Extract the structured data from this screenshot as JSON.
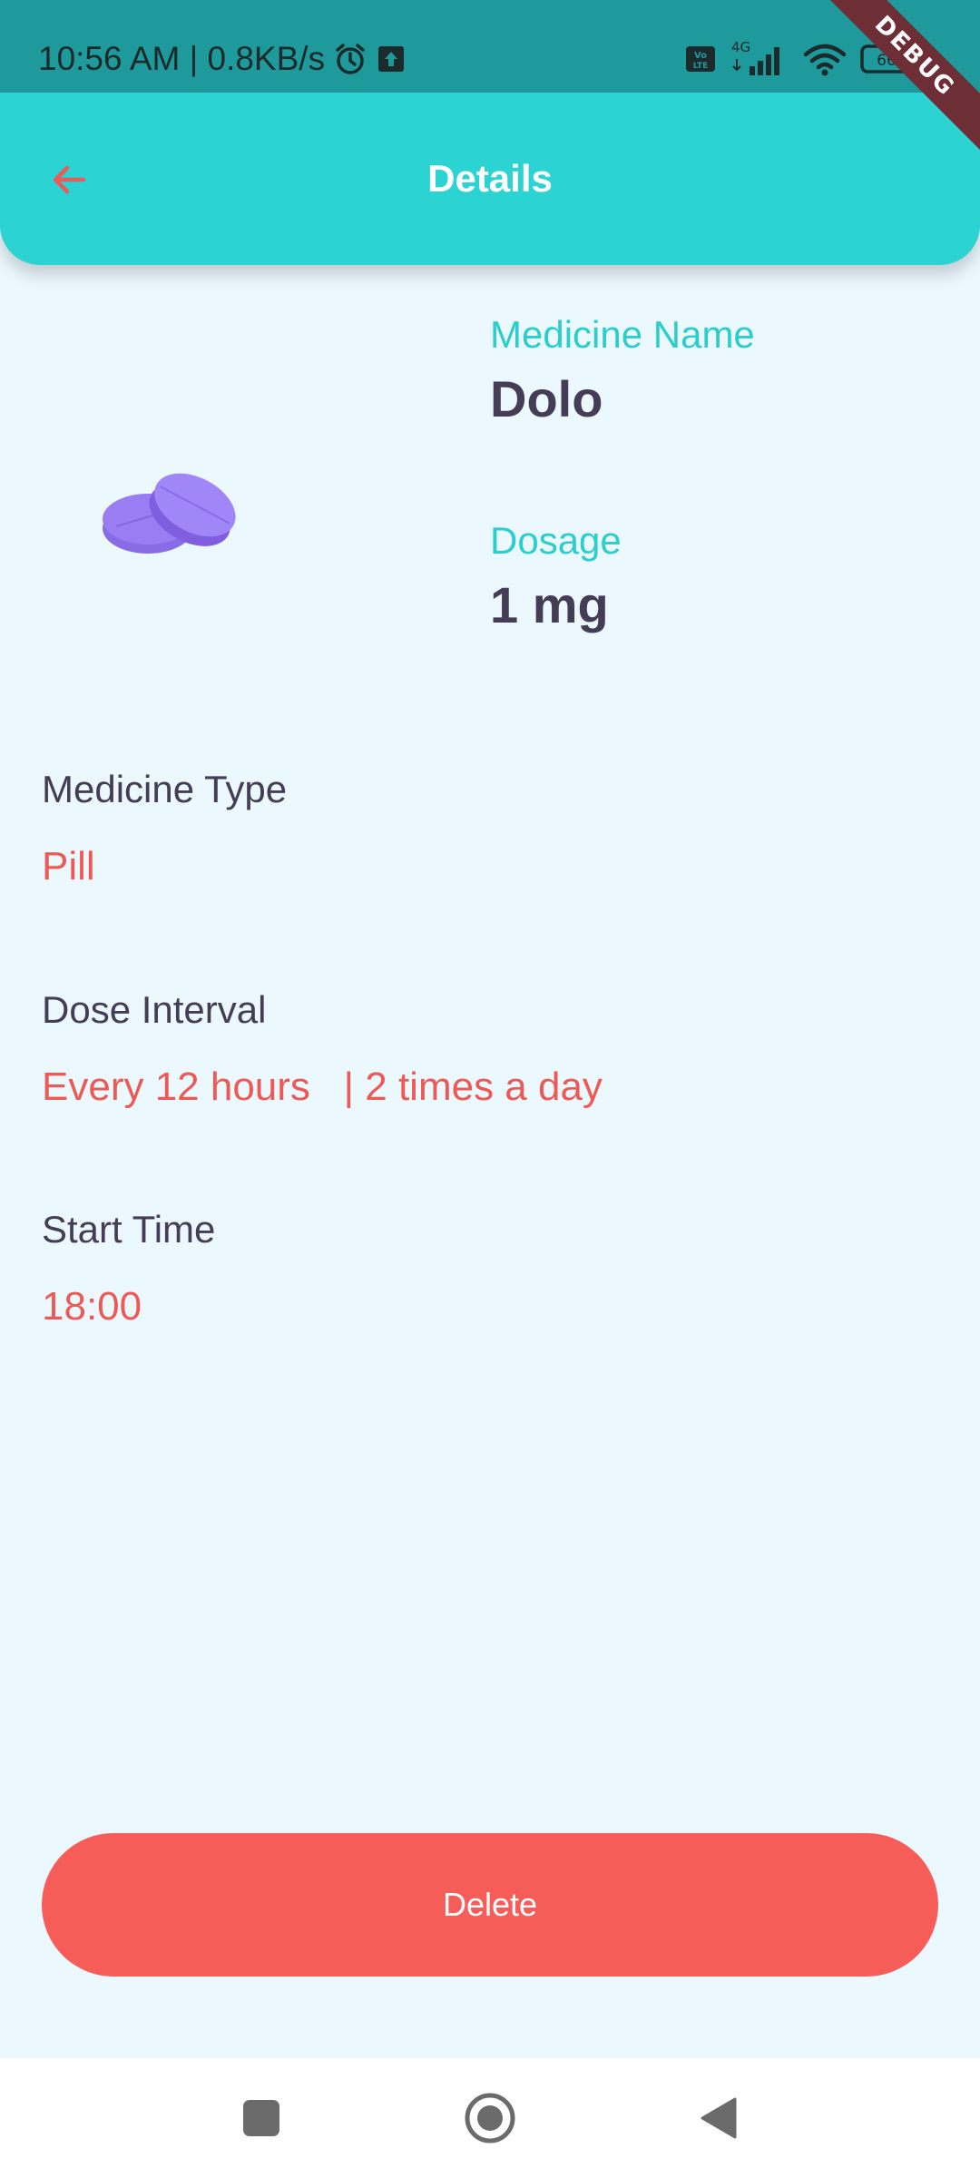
{
  "status_bar": {
    "time_speed": "10:56 AM | 0.8KB/s",
    "network": "4G",
    "volte": "Vo LTE",
    "battery": "66",
    "icons": [
      "alarm-icon",
      "upload-icon",
      "volte-icon",
      "signal-icon",
      "wifi-icon",
      "battery-icon"
    ]
  },
  "debug_banner": "DEBUG",
  "app_bar": {
    "title": "Details",
    "back_icon": "arrow-left-icon"
  },
  "medicine": {
    "name_label": "Medicine Name",
    "name": "Dolo",
    "dosage_label": "Dosage",
    "dosage": "1 mg",
    "image_icon": "pill-icon"
  },
  "details": {
    "type_label": "Medicine Type",
    "type": "Pill",
    "interval_label": "Dose Interval",
    "interval": "Every 12 hours   | 2 times a day",
    "start_label": "Start Time",
    "start": "18:00"
  },
  "actions": {
    "delete_label": "Delete"
  },
  "colors": {
    "teal": "#2bd3d3",
    "coral": "#f75d58",
    "dark_text": "#453d55",
    "background": "#ebf8fe",
    "pill": "#9a7cf3"
  }
}
